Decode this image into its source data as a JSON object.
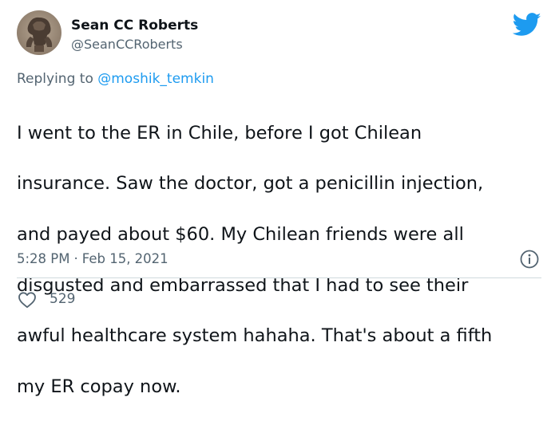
{
  "author": {
    "display_name": "Sean CC Roberts",
    "handle": "@SeanCCRoberts"
  },
  "reply": {
    "prefix": "Replying to",
    "mention": "@moshik_temkin"
  },
  "tweet": {
    "lines": [
      "I went to the ER in Chile, before I got Chilean",
      "insurance. Saw the doctor, got a penicillin injection,",
      "and payed about $60. My Chilean friends were all",
      "disgusted and embarrassed that I had to see their",
      "awful healthcare system hahaha. That's about a fifth",
      "my ER copay now."
    ]
  },
  "meta": {
    "time": "5:28 PM",
    "separator": "·",
    "date": "Feb 15, 2021"
  },
  "stats": {
    "likes": "529"
  },
  "icons": {
    "brand": "twitter-bird-icon",
    "info": "info-icon",
    "like": "heart-icon"
  },
  "colors": {
    "brand_blue": "#1d9bf0",
    "secondary_text": "#536471",
    "primary_text": "#0f1419",
    "divider": "#cfd9de"
  }
}
